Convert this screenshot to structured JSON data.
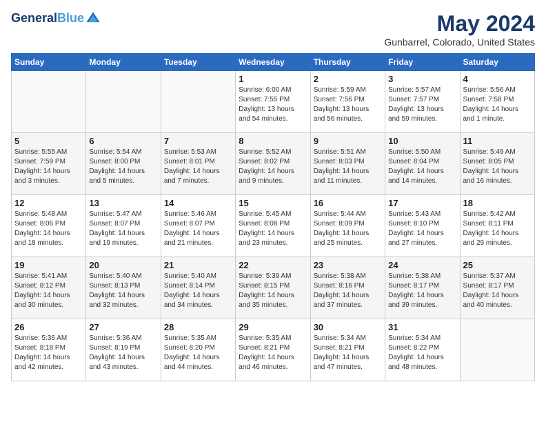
{
  "logo": {
    "line1": "General",
    "line2": "Blue"
  },
  "title": "May 2024",
  "location": "Gunbarrel, Colorado, United States",
  "days_of_week": [
    "Sunday",
    "Monday",
    "Tuesday",
    "Wednesday",
    "Thursday",
    "Friday",
    "Saturday"
  ],
  "weeks": [
    [
      {
        "day": "",
        "info": ""
      },
      {
        "day": "",
        "info": ""
      },
      {
        "day": "",
        "info": ""
      },
      {
        "day": "1",
        "info": "Sunrise: 6:00 AM\nSunset: 7:55 PM\nDaylight: 13 hours\nand 54 minutes."
      },
      {
        "day": "2",
        "info": "Sunrise: 5:59 AM\nSunset: 7:56 PM\nDaylight: 13 hours\nand 56 minutes."
      },
      {
        "day": "3",
        "info": "Sunrise: 5:57 AM\nSunset: 7:57 PM\nDaylight: 13 hours\nand 59 minutes."
      },
      {
        "day": "4",
        "info": "Sunrise: 5:56 AM\nSunset: 7:58 PM\nDaylight: 14 hours\nand 1 minute."
      }
    ],
    [
      {
        "day": "5",
        "info": "Sunrise: 5:55 AM\nSunset: 7:59 PM\nDaylight: 14 hours\nand 3 minutes."
      },
      {
        "day": "6",
        "info": "Sunrise: 5:54 AM\nSunset: 8:00 PM\nDaylight: 14 hours\nand 5 minutes."
      },
      {
        "day": "7",
        "info": "Sunrise: 5:53 AM\nSunset: 8:01 PM\nDaylight: 14 hours\nand 7 minutes."
      },
      {
        "day": "8",
        "info": "Sunrise: 5:52 AM\nSunset: 8:02 PM\nDaylight: 14 hours\nand 9 minutes."
      },
      {
        "day": "9",
        "info": "Sunrise: 5:51 AM\nSunset: 8:03 PM\nDaylight: 14 hours\nand 11 minutes."
      },
      {
        "day": "10",
        "info": "Sunrise: 5:50 AM\nSunset: 8:04 PM\nDaylight: 14 hours\nand 14 minutes."
      },
      {
        "day": "11",
        "info": "Sunrise: 5:49 AM\nSunset: 8:05 PM\nDaylight: 14 hours\nand 16 minutes."
      }
    ],
    [
      {
        "day": "12",
        "info": "Sunrise: 5:48 AM\nSunset: 8:06 PM\nDaylight: 14 hours\nand 18 minutes."
      },
      {
        "day": "13",
        "info": "Sunrise: 5:47 AM\nSunset: 8:07 PM\nDaylight: 14 hours\nand 19 minutes."
      },
      {
        "day": "14",
        "info": "Sunrise: 5:46 AM\nSunset: 8:07 PM\nDaylight: 14 hours\nand 21 minutes."
      },
      {
        "day": "15",
        "info": "Sunrise: 5:45 AM\nSunset: 8:08 PM\nDaylight: 14 hours\nand 23 minutes."
      },
      {
        "day": "16",
        "info": "Sunrise: 5:44 AM\nSunset: 8:09 PM\nDaylight: 14 hours\nand 25 minutes."
      },
      {
        "day": "17",
        "info": "Sunrise: 5:43 AM\nSunset: 8:10 PM\nDaylight: 14 hours\nand 27 minutes."
      },
      {
        "day": "18",
        "info": "Sunrise: 5:42 AM\nSunset: 8:11 PM\nDaylight: 14 hours\nand 29 minutes."
      }
    ],
    [
      {
        "day": "19",
        "info": "Sunrise: 5:41 AM\nSunset: 8:12 PM\nDaylight: 14 hours\nand 30 minutes."
      },
      {
        "day": "20",
        "info": "Sunrise: 5:40 AM\nSunset: 8:13 PM\nDaylight: 14 hours\nand 32 minutes."
      },
      {
        "day": "21",
        "info": "Sunrise: 5:40 AM\nSunset: 8:14 PM\nDaylight: 14 hours\nand 34 minutes."
      },
      {
        "day": "22",
        "info": "Sunrise: 5:39 AM\nSunset: 8:15 PM\nDaylight: 14 hours\nand 35 minutes."
      },
      {
        "day": "23",
        "info": "Sunrise: 5:38 AM\nSunset: 8:16 PM\nDaylight: 14 hours\nand 37 minutes."
      },
      {
        "day": "24",
        "info": "Sunrise: 5:38 AM\nSunset: 8:17 PM\nDaylight: 14 hours\nand 39 minutes."
      },
      {
        "day": "25",
        "info": "Sunrise: 5:37 AM\nSunset: 8:17 PM\nDaylight: 14 hours\nand 40 minutes."
      }
    ],
    [
      {
        "day": "26",
        "info": "Sunrise: 5:36 AM\nSunset: 8:18 PM\nDaylight: 14 hours\nand 42 minutes."
      },
      {
        "day": "27",
        "info": "Sunrise: 5:36 AM\nSunset: 8:19 PM\nDaylight: 14 hours\nand 43 minutes."
      },
      {
        "day": "28",
        "info": "Sunrise: 5:35 AM\nSunset: 8:20 PM\nDaylight: 14 hours\nand 44 minutes."
      },
      {
        "day": "29",
        "info": "Sunrise: 5:35 AM\nSunset: 8:21 PM\nDaylight: 14 hours\nand 46 minutes."
      },
      {
        "day": "30",
        "info": "Sunrise: 5:34 AM\nSunset: 8:21 PM\nDaylight: 14 hours\nand 47 minutes."
      },
      {
        "day": "31",
        "info": "Sunrise: 5:34 AM\nSunset: 8:22 PM\nDaylight: 14 hours\nand 48 minutes."
      },
      {
        "day": "",
        "info": ""
      }
    ]
  ]
}
